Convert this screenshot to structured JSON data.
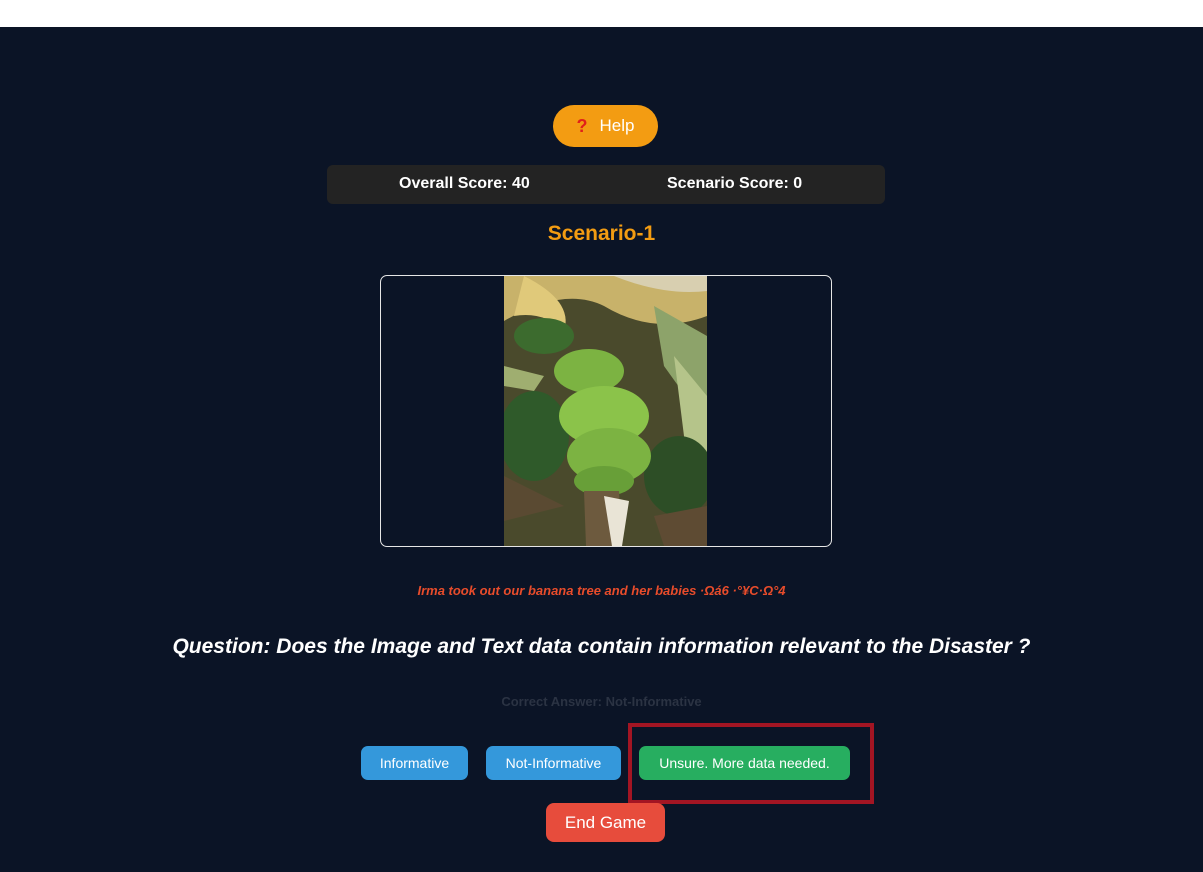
{
  "help": {
    "label": "Help",
    "icon": "question-icon"
  },
  "scores": {
    "overall": "Overall Score: 40",
    "scenario": "Scenario Score: 0"
  },
  "scenario": {
    "title": "Scenario-1",
    "image_subject": "green banana bunch on fallen banana tree",
    "caption": "Irma took out our banana tree and her babies ·Ωá6 ·°¥C·Ω°4"
  },
  "question": "Question: Does the Image and Text data contain information relevant to the Disaster ?",
  "correct_answer": "Correct Answer: Not-Informative",
  "choices": {
    "informative": "Informative",
    "not_informative": "Not-Informative",
    "unsure": "Unsure. More data needed."
  },
  "end_game": "End Game",
  "colors": {
    "background": "#0b1426",
    "accent_orange": "#f39c12",
    "blue_button": "#3498db",
    "green_button": "#27ae60",
    "red_button": "#e74c3c",
    "caption_red": "#e84c2b",
    "highlight_box": "#a31523"
  }
}
